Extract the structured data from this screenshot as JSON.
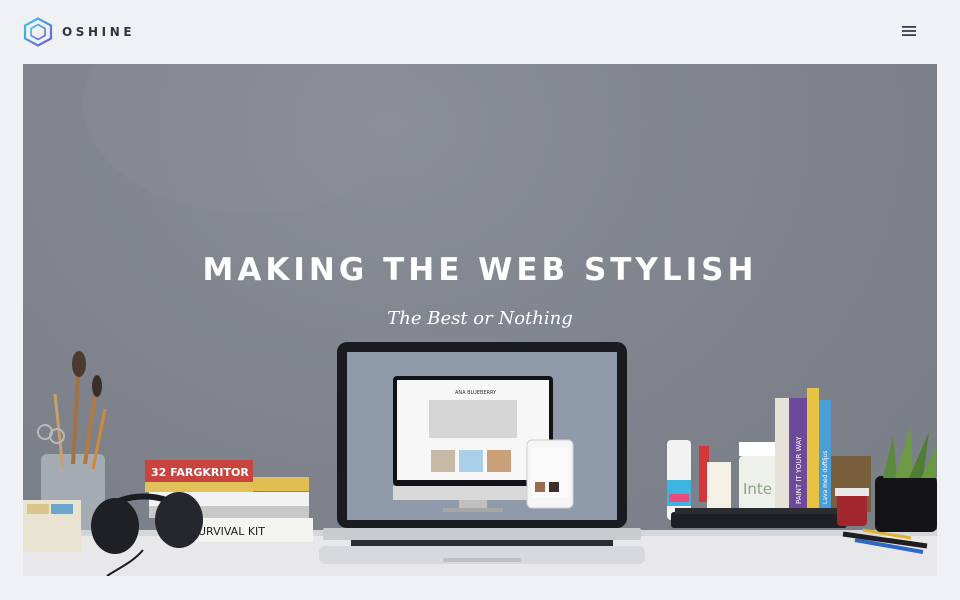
{
  "header": {
    "brand": "OSHINE",
    "logo_icon": "hexagon-logo-icon",
    "menu_icon": "hamburger-menu-icon"
  },
  "hero": {
    "title": "MAKING THE WEB STYLISH",
    "subtitle": "The Best or Nothing",
    "photo_labels": {
      "chalk_box": "32 FARGKRITOR",
      "book": "SURVIVAL KIT",
      "jar": "Inte",
      "screen_brand": "ANA BLUEBERRY",
      "book_spine_1": "PAINT IT YOUR WAY",
      "book_spine_2": "Lava med doftljus"
    }
  },
  "colors": {
    "page_background": "#f0f1f5",
    "hero_background": "#7f838c",
    "brand_text": "#2f3440",
    "logo_blue": "#3aa0e8",
    "logo_purple": "#6b5bd6"
  }
}
